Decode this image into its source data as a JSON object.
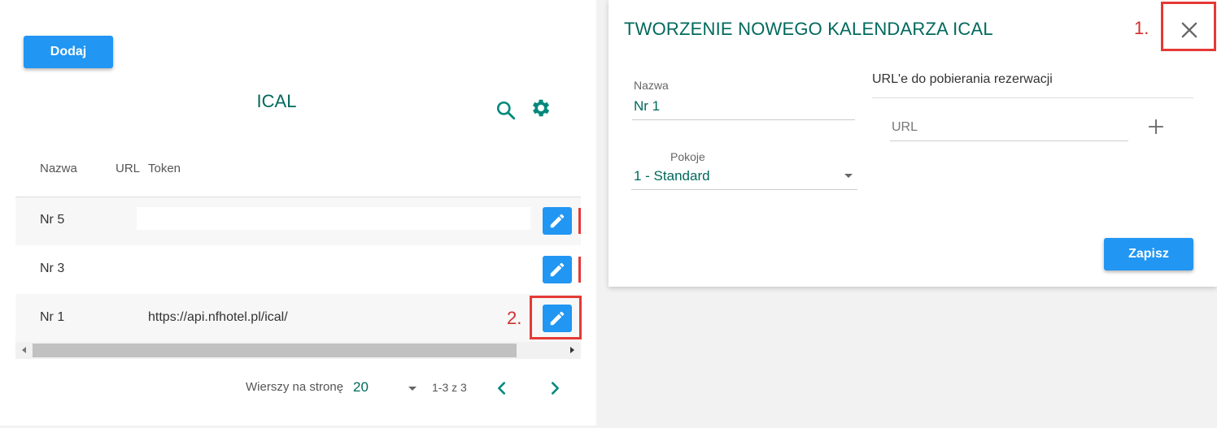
{
  "list": {
    "add_label": "Dodaj",
    "title": "ICAL",
    "columns": {
      "name": "Nazwa",
      "url": "URL",
      "token": "Token"
    },
    "rows": [
      {
        "name": "Nr 5",
        "url": ""
      },
      {
        "name": "Nr 3",
        "url": ""
      },
      {
        "name": "Nr 1",
        "url": "https://api.nfhotel.pl/ical/"
      }
    ],
    "pager": {
      "rows_label": "Wierszy na stronę",
      "rows_value": "20",
      "range": "1-3 z 3"
    }
  },
  "dialog": {
    "title": "TWORZENIE NOWEGO KALENDARZA ICAL",
    "name_label": "Nazwa",
    "name_value": "Nr 1",
    "rooms_label": "Pokoje",
    "rooms_value": "1 - Standard",
    "urls_title": "URL'e do pobierania rezerwacji",
    "url_placeholder": "URL",
    "save_label": "Zapisz"
  },
  "callouts": {
    "close": "1.",
    "edit": "2."
  },
  "colors": {
    "accent": "#2196f3",
    "teal": "#00695c",
    "callout": "#e53935"
  }
}
